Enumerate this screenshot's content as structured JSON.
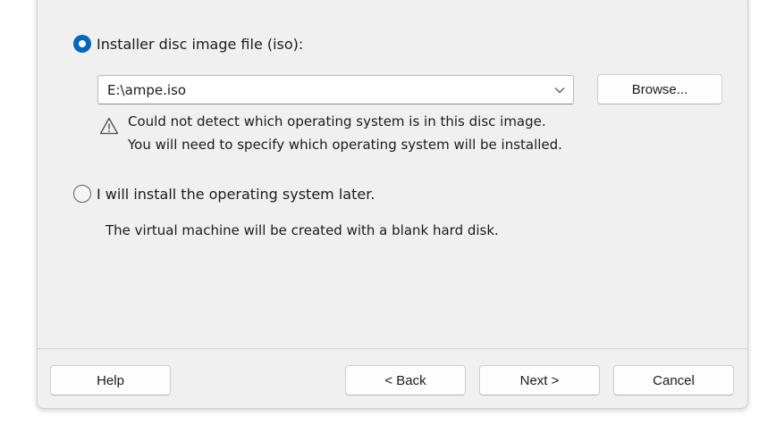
{
  "install_source": {
    "iso_option_label": "Installer disc image file (iso):",
    "iso_path": "E:\\ampe.iso",
    "browse_label": "Browse...",
    "warning_line1": "Could not detect which operating system is in this disc image.",
    "warning_line2": "You will need to specify which operating system will be installed.",
    "later_option_label": "I will install the operating system later.",
    "later_note": "The virtual machine will be created with a blank hard disk."
  },
  "footer": {
    "help_label": "Help",
    "back_label": "< Back",
    "next_label": "Next >",
    "cancel_label": "Cancel"
  },
  "colors": {
    "accent": "#0067c0",
    "dialog_background": "#f0f0f0"
  },
  "icons": {
    "warning": "warning-triangle-icon",
    "dropdown": "chevron-down-icon"
  }
}
